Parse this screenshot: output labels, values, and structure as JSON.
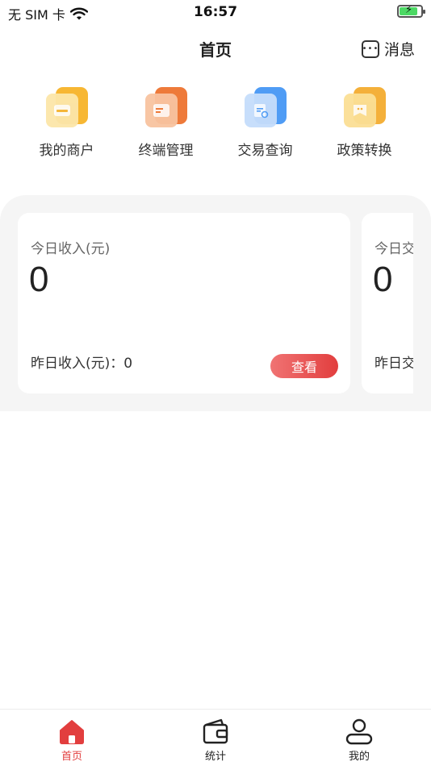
{
  "status_bar": {
    "carrier": "无 SIM 卡",
    "time": "16:57",
    "icons": [
      "wifi-icon",
      "battery-charging-icon"
    ]
  },
  "nav": {
    "title": "首页",
    "message_label": "消息",
    "message_icon": "message-icon"
  },
  "quick_entries": [
    {
      "label": "我的商户",
      "icon": "merchant-icon",
      "color": "#f5b63a"
    },
    {
      "label": "终端管理",
      "icon": "terminal-icon",
      "color": "#ee7a3a"
    },
    {
      "label": "交易查询",
      "icon": "transaction-query-icon",
      "color": "#4f9cf5"
    },
    {
      "label": "政策转换",
      "icon": "policy-icon",
      "color": "#f4b03a"
    }
  ],
  "cards": [
    {
      "label": "今日收入(元)",
      "value": "0",
      "yesterday": "昨日收入(元)：0",
      "button": "查看"
    },
    {
      "label": "今日交",
      "value": "0",
      "yesterday": "昨日交"
    }
  ],
  "tabs": [
    {
      "label": "首页",
      "icon": "home-icon",
      "active": true
    },
    {
      "label": "统计",
      "icon": "wallet-icon",
      "active": false
    },
    {
      "label": "我的",
      "icon": "user-icon",
      "active": false
    }
  ],
  "colors": {
    "accent": "#e23e3e",
    "card_bg": "#f5f5f5"
  }
}
